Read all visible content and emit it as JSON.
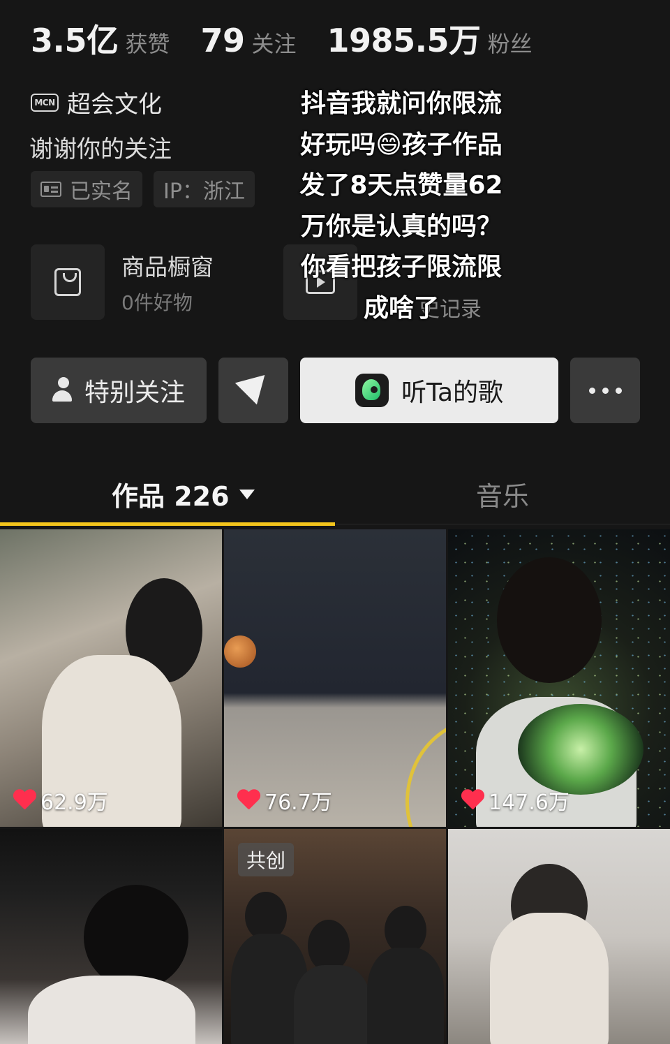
{
  "stats": [
    {
      "num": "3.5亿",
      "label": "获赞"
    },
    {
      "num": "79",
      "label": "关注"
    },
    {
      "num": "1985.5万",
      "label": "粉丝"
    }
  ],
  "mcn": {
    "badge": "MCN",
    "name": "超会文化"
  },
  "bio": "谢谢你的关注",
  "tags": {
    "verified": "已实名",
    "ip": "IP：浙江"
  },
  "shop": {
    "title": "商品橱窗",
    "sub": "0件好物"
  },
  "history": {
    "label": "史记录",
    "icon": "play-icon"
  },
  "overlay_caption": [
    "抖音我就问你限流",
    "好玩吗😄孩子作品",
    "发了8天点赞量62",
    "万你是认真的吗？",
    "你看把孩子限流限",
    "成啥了"
  ],
  "buttons": {
    "follow": "特别关注",
    "music": "听Ta的歌",
    "more_icon": "more-dots-icon",
    "send_icon": "send-icon"
  },
  "tabs": {
    "works": "作品 226",
    "music": "音乐",
    "active_color": "#f4c51c"
  },
  "videos": [
    {
      "likes": "62.9万"
    },
    {
      "likes": "76.7万"
    },
    {
      "likes": "147.6万"
    },
    {
      "likes": ""
    },
    {
      "likes": "",
      "badge": "共创"
    },
    {
      "likes": ""
    }
  ],
  "colors": {
    "background": "#161616",
    "heart": "#ff2f4e",
    "accent": "#f4c51c"
  }
}
